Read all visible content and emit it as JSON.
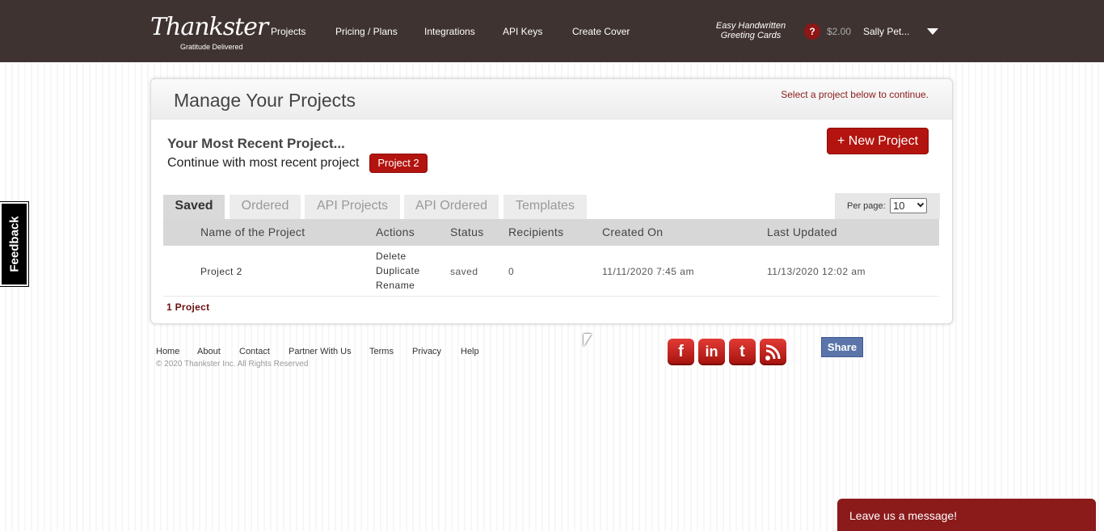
{
  "header": {
    "logo_script": "Thankster",
    "logo_tagline": "Gratitude Delivered",
    "nav": [
      "Projects",
      "Pricing / Plans",
      "Integrations",
      "API Keys",
      "Create Cover"
    ],
    "tagline_line1": "Easy Handwritten",
    "tagline_line2": "Greeting Cards",
    "help_label": "?",
    "balance": "$2.00",
    "user": "Sally Pet..."
  },
  "feedback": {
    "label": "Feedback"
  },
  "panel": {
    "title": "Manage Your Projects",
    "hint": "Select a project below to continue.",
    "recent_title": "Your Most Recent Project...",
    "recent_continue": "Continue with most recent project",
    "recent_project_button": "Project 2",
    "new_project_button": "+ New Project"
  },
  "tabs": [
    "Saved",
    "Ordered",
    "API Projects",
    "API Ordered",
    "Templates"
  ],
  "per_page": {
    "label": "Per page:",
    "value": "10"
  },
  "table": {
    "headers": [
      "Name of the Project",
      "Actions",
      "Status",
      "Recipients",
      "Created On",
      "Last Updated"
    ],
    "rows": [
      {
        "name": "Project 2",
        "actions": [
          "Delete",
          "Duplicate",
          "Rename"
        ],
        "status": "saved",
        "recipients": "0",
        "created": "11/11/2020 7:45 am",
        "updated": "11/13/2020 12:02 am"
      }
    ],
    "count": "1 Project"
  },
  "footer": {
    "links": [
      "Home",
      "About",
      "Contact",
      "Partner With Us",
      "Terms",
      "Privacy",
      "Help"
    ],
    "copyright": "© 2020 Thankster Inc. All Rights Reserved",
    "social": [
      "f",
      "in",
      "t"
    ],
    "share_label": "Share"
  },
  "chat": {
    "label": "Leave us a message!"
  },
  "colors": {
    "header_bg": "#3f3331",
    "accent_red": "#b3140f",
    "chat_bg": "#8b1a1a"
  },
  "icons": {
    "social": [
      "facebook-icon",
      "linkedin-icon",
      "tumblr-icon",
      "rss-icon"
    ]
  }
}
